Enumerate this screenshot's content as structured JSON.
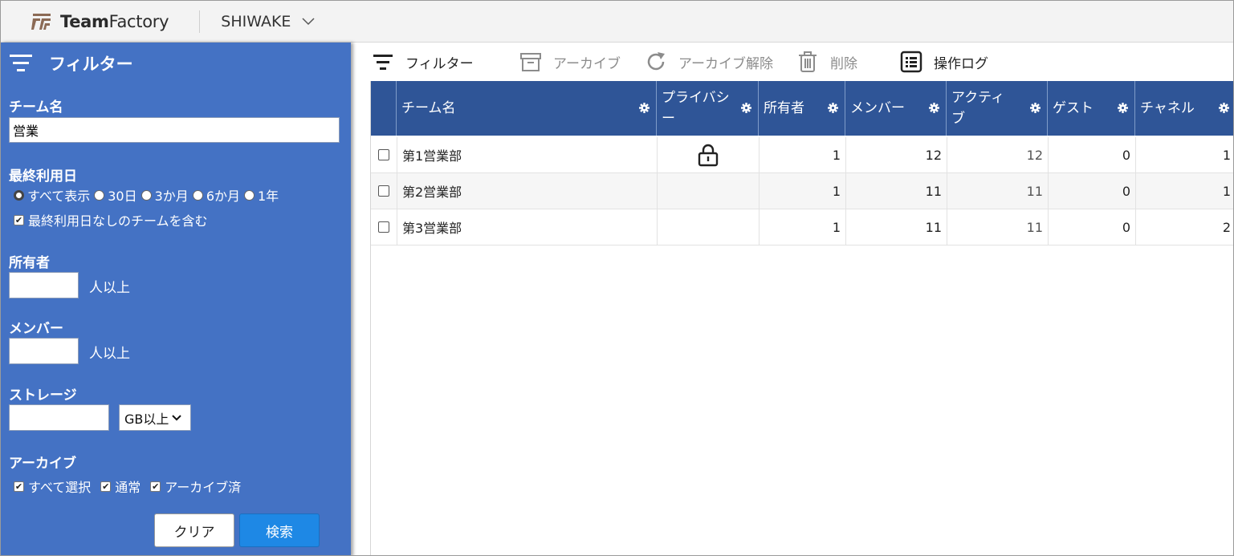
{
  "app": {
    "logo_bold": "Team",
    "logo_light": "Factory",
    "workspace": "SHIWAKE"
  },
  "colors": {
    "sidebar_bg": "#4472c4",
    "table_header_bg": "#2f5597",
    "search_button": "#1e88e5"
  },
  "sidebar": {
    "title": "フィルター",
    "team_name": {
      "label": "チーム名",
      "value": "営業"
    },
    "last_used": {
      "label": "最終利用日",
      "options": [
        "すべて表示",
        "30日",
        "3か月",
        "6か月",
        "1年"
      ],
      "selected": "すべて表示",
      "include_none_label": "最終利用日なしのチームを含む",
      "include_none_checked": true
    },
    "owner": {
      "label": "所有者",
      "value": "",
      "suffix": "人以上"
    },
    "member": {
      "label": "メンバー",
      "value": "",
      "suffix": "人以上"
    },
    "storage": {
      "label": "ストレージ",
      "value": "",
      "unit": "GB以上"
    },
    "archive": {
      "label": "アーカイブ",
      "options": [
        {
          "label": "すべて選択",
          "checked": true
        },
        {
          "label": "通常",
          "checked": true
        },
        {
          "label": "アーカイブ済",
          "checked": true
        }
      ]
    },
    "clear_button": "クリア",
    "search_button": "検索"
  },
  "toolbar": {
    "filter": "フィルター",
    "archive": "アーカイブ",
    "unarchive": "アーカイブ解除",
    "delete": "削除",
    "log": "操作ログ"
  },
  "table": {
    "columns": [
      "チーム名",
      "プライバシー",
      "所有者",
      "メンバー",
      "アクティブ",
      "ゲスト",
      "チャネル"
    ],
    "rows": [
      {
        "name": "第1営業部",
        "private": true,
        "owners": "1",
        "members": "12",
        "active": "12",
        "guests": "0",
        "channels": "1"
      },
      {
        "name": "第2営業部",
        "private": false,
        "owners": "1",
        "members": "11",
        "active": "11",
        "guests": "0",
        "channels": "1"
      },
      {
        "name": "第3営業部",
        "private": false,
        "owners": "1",
        "members": "11",
        "active": "11",
        "guests": "0",
        "channels": "2"
      }
    ]
  }
}
